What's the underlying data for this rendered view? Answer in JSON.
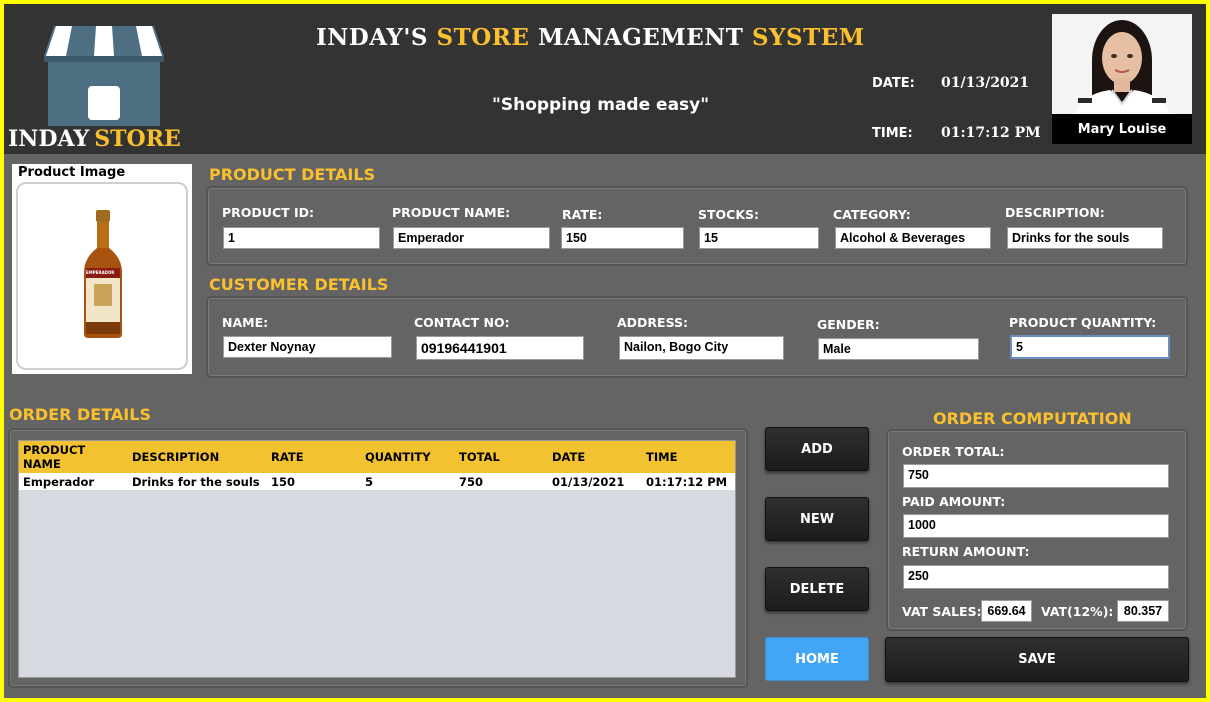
{
  "header": {
    "title_part1": "INDAY'S",
    "title_part2": "STORE",
    "title_part3": "MANAGEMENT",
    "title_part4": "SYSTEM",
    "tagline": "\"Shopping made easy\"",
    "logo_word1": "INDAY",
    "logo_word2": "STORE",
    "date_label": "DATE:",
    "date_value": "01/13/2021",
    "time_label": "TIME:",
    "time_value": "01:17:12 PM",
    "user_name": "Mary Louise"
  },
  "product_image": {
    "label": "Product Image",
    "bottle_label": "EMPERADOR"
  },
  "product_details": {
    "title": "PRODUCT DETAILS",
    "id_label": "PRODUCT ID:",
    "id_value": "1",
    "name_label": "PRODUCT NAME:",
    "name_value": "Emperador",
    "rate_label": "RATE:",
    "rate_value": "150",
    "stocks_label": "STOCKS:",
    "stocks_value": "15",
    "category_label": "CATEGORY:",
    "category_value": "Alcohol & Beverages",
    "description_label": "DESCRIPTION:",
    "description_value": "Drinks for the souls"
  },
  "customer_details": {
    "title": "CUSTOMER DETAILS",
    "name_label": "NAME:",
    "name_value": "Dexter Noynay",
    "contact_label": "CONTACT NO:",
    "contact_value": "09196441901",
    "address_label": "ADDRESS:",
    "address_value": "Nailon, Bogo City",
    "gender_label": "GENDER:",
    "gender_value": "Male",
    "quantity_label": "PRODUCT QUANTITY:",
    "quantity_value": "5"
  },
  "order_details": {
    "title": "ORDER DETAILS",
    "columns": [
      "PRODUCT NAME",
      "DESCRIPTION",
      "RATE",
      "QUANTITY",
      "TOTAL",
      "DATE",
      "TIME"
    ],
    "rows": [
      [
        "Emperador",
        "Drinks for the souls",
        "150",
        "5",
        "750",
        "01/13/2021",
        "01:17:12 PM"
      ]
    ]
  },
  "buttons": {
    "add": "ADD",
    "new": "NEW",
    "delete": "DELETE",
    "home": "HOME",
    "save": "SAVE"
  },
  "order_computation": {
    "title": "ORDER COMPUTATION",
    "order_total_label": "ORDER TOTAL:",
    "order_total_value": "750",
    "paid_amount_label": "PAID AMOUNT:",
    "paid_amount_value": "1000",
    "return_amount_label": "RETURN AMOUNT:",
    "return_amount_value": "250",
    "vat_sales_label": "VAT SALES:",
    "vat_sales_value": "669.64",
    "vat_label": "VAT(12%):",
    "vat_value": "80.357"
  },
  "colors": {
    "accent": "#fbc02d",
    "header_bg": "#333333",
    "body_bg": "#646464",
    "frame": "#ffff00",
    "home_button": "#42a5f5"
  }
}
